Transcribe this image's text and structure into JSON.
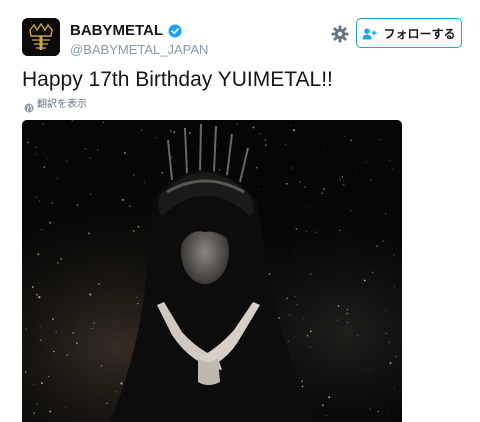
{
  "account": {
    "display_name": "BABYMETAL",
    "handle": "@BABYMETAL_JAPAN",
    "avatar_label": "BABYMETAL"
  },
  "actions": {
    "settings_icon": "gear-icon",
    "follow_label": "フォローする",
    "follow_icon": "add-user-icon"
  },
  "tweet": {
    "text": "Happy 17th Birthday YUIMETAL!!",
    "translate_label": "翻訳を表示"
  },
  "colors": {
    "accent": "#1da1f2",
    "name": "#14171a",
    "secondary": "#8899a6"
  }
}
